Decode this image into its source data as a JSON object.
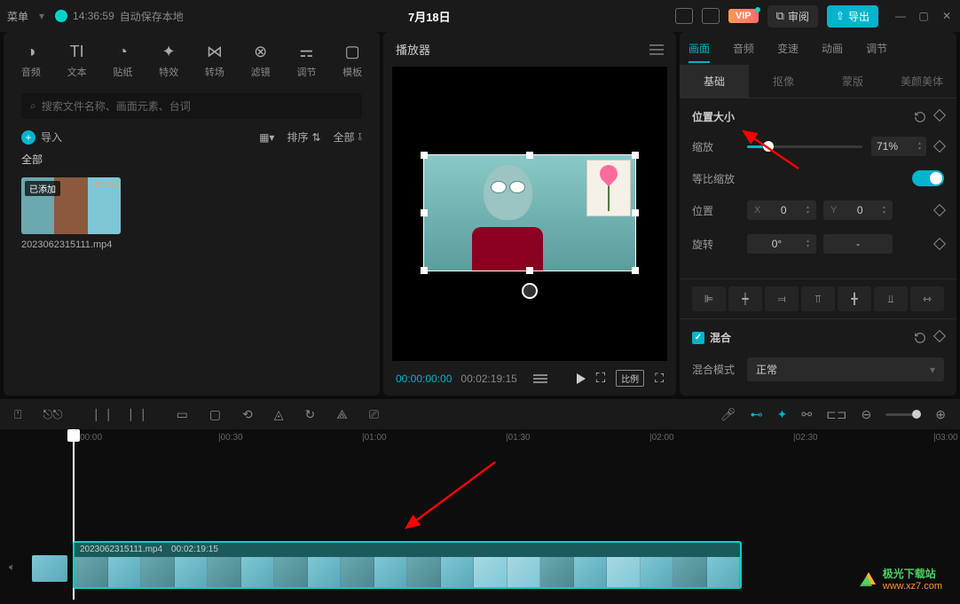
{
  "titlebar": {
    "menu_left": "菜单",
    "save_time": "14:36:59",
    "save_label": "自动保存本地",
    "title": "7月18日",
    "review": "审阅",
    "export": "导出",
    "vip": "VIP"
  },
  "top_tabs": [
    "音频",
    "文本",
    "贴纸",
    "特效",
    "转场",
    "滤镜",
    "调节",
    "模板"
  ],
  "media": {
    "search_placeholder": "搜索文件名称、画面元素、台词",
    "import": "导入",
    "sort": "排序",
    "all": "全部",
    "tab_all": "全部",
    "item_added": "已添加",
    "item_dur": "02:20",
    "item_name": "2023062315111.mp4"
  },
  "player": {
    "title": "播放器",
    "time_current": "00:00:00:00",
    "time_total": "00:02:19:15",
    "proportion": "比例"
  },
  "right_tabs": [
    "画面",
    "音频",
    "变速",
    "动画",
    "调节"
  ],
  "right_subtabs": [
    "基础",
    "抠像",
    "蒙版",
    "美颜美体"
  ],
  "props": {
    "position_size": "位置大小",
    "scale": "缩放",
    "scale_value": "71%",
    "ratio_scale": "等比缩放",
    "position": "位置",
    "pos_x_label": "X",
    "pos_x_val": "0",
    "pos_y_label": "Y",
    "pos_y_val": "0",
    "rotation": "旋转",
    "rotation_val": "0°",
    "rotation_dash": "-",
    "blend": "混合",
    "blend_mode": "混合模式",
    "blend_mode_val": "正常"
  },
  "timeline": {
    "playhead_time": "00:00",
    "ticks": [
      "|00:30",
      "|01:00",
      "|01:30",
      "|02:00",
      "|02:30",
      "|03:00"
    ],
    "clip_name": "2023062315111.mp4",
    "clip_dur": "00:02:19:15"
  },
  "watermark": {
    "name": "极光下载站",
    "url": "www.xz7.com"
  }
}
